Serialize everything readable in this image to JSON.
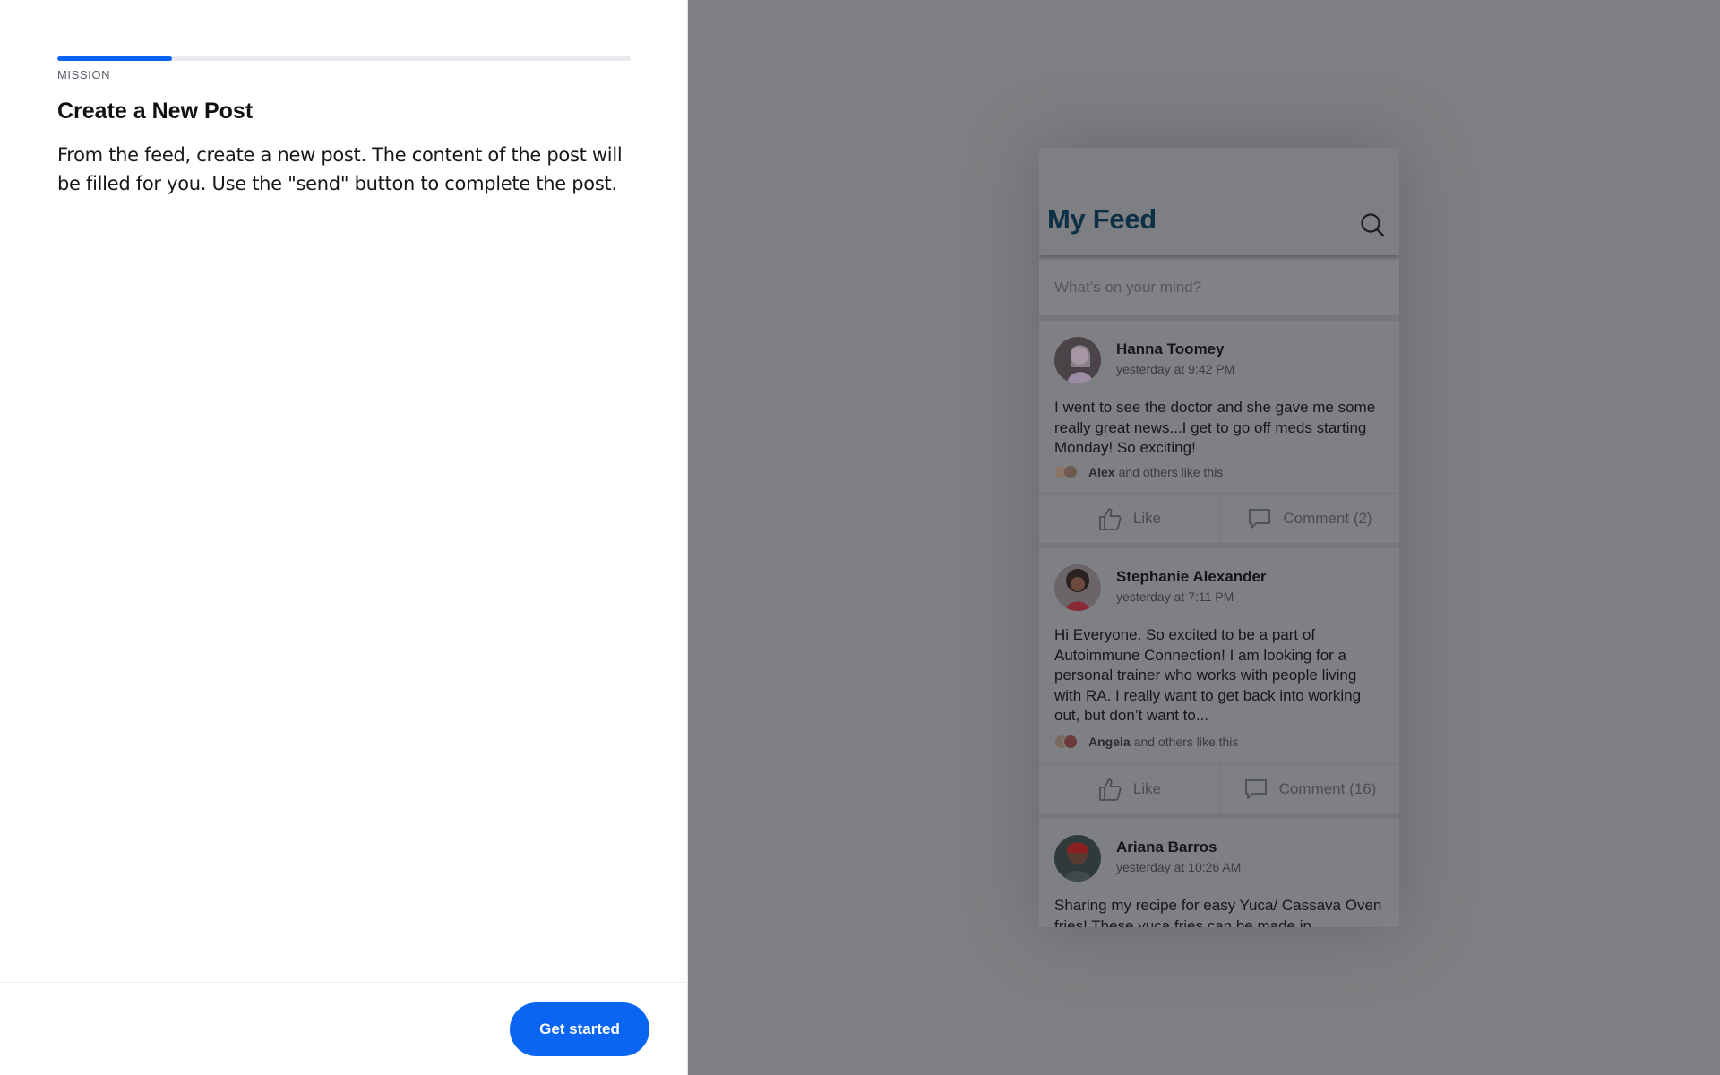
{
  "mission": {
    "progress_fraction": 0.2,
    "label": "MISSION",
    "title": "Create a New Post",
    "description": "From the feed, create a new post. The content of the post will be filled for you. Use the \"send\" button to complete the post.",
    "get_started_label": "Get started"
  },
  "feed": {
    "title": "My Feed",
    "search_icon": "search-icon",
    "composer_placeholder": "What’s on your mind?",
    "posts": [
      {
        "author": "Hanna Toomey",
        "timestamp": "yesterday at 9:42 PM",
        "body": "I went to see the doctor and she gave me some really great news...I get to go off meds starting Monday! So exciting!",
        "liker": "Alex",
        "likes_suffix": "and others like this",
        "like_label": "Like",
        "comment_label": "Comment (2)"
      },
      {
        "author": "Stephanie Alexander",
        "timestamp": "yesterday at 7:11 PM",
        "body": "Hi Everyone. So excited to be a part of Autoimmune Connection! I am looking for a personal trainer who works with people living with RA. I really want to get back into working out, but don’t want to...",
        "liker": "Angela",
        "likes_suffix": "and others like this",
        "like_label": "Like",
        "comment_label": "Comment (16)"
      },
      {
        "author": "Ariana Barros",
        "timestamp": "yesterday at 10:26 AM",
        "body": "Sharing my recipe for easy Yuca/ Cassava Oven fries! These yuca fries can be made in"
      }
    ]
  },
  "colors": {
    "accent": "#0a66f2",
    "overlay": "#7d7f82",
    "feed_title": "#0e3046"
  }
}
